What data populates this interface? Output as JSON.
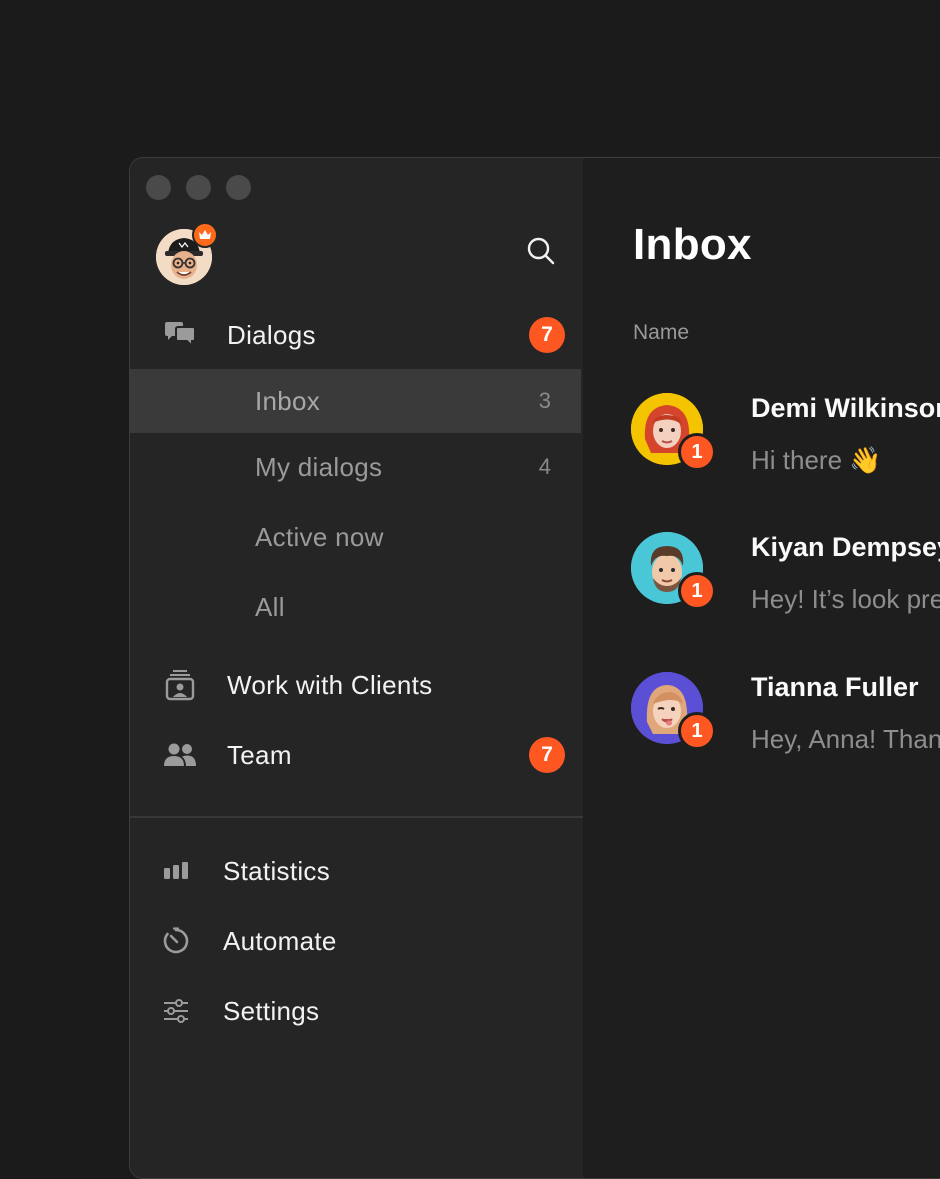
{
  "window": {
    "traffic_lights": [
      "close",
      "minimize",
      "zoom"
    ]
  },
  "sidebar": {
    "profile": {
      "avatar_icon": "memoji-avatar-cap-glasses",
      "badge_icon": "crown-icon"
    },
    "search_icon": "search-icon",
    "primary_nav": [
      {
        "label": "Dialogs",
        "icon": "chat-bubbles-icon",
        "badge": "7"
      },
      {
        "label": "Work with Clients",
        "icon": "contact-card-icon"
      },
      {
        "label": "Team",
        "icon": "people-icon",
        "badge": "7"
      }
    ],
    "dialogs_subnav": [
      {
        "label": "Inbox",
        "count": "3",
        "selected": true
      },
      {
        "label": "My dialogs",
        "count": "4"
      },
      {
        "label": "Active now"
      },
      {
        "label": "All"
      }
    ],
    "secondary_nav": [
      {
        "label": "Statistics",
        "icon": "bar-chart-icon"
      },
      {
        "label": "Automate",
        "icon": "timer-icon"
      },
      {
        "label": "Settings",
        "icon": "sliders-icon"
      }
    ]
  },
  "main": {
    "title": "Inbox",
    "column_header": "Name",
    "conversations": [
      {
        "name": "Demi Wilkinson",
        "message": "Hi there 👋",
        "unread": "1",
        "avatar_color": "#f5c400"
      },
      {
        "name": "Kiyan Dempsey",
        "message": "Hey! It’s look pretty",
        "unread": "1",
        "avatar_color": "#4ac7d6"
      },
      {
        "name": "Tianna Fuller",
        "message": "Hey, Anna! Thanks",
        "unread": "1",
        "avatar_color": "#5b4fd6"
      }
    ]
  },
  "colors": {
    "accent": "#ff5722",
    "crown_badge": "#ff6a1a",
    "sidebar_bg": "#252525",
    "main_bg": "#1e1e1e",
    "selected_row": "#3a3a3a"
  }
}
